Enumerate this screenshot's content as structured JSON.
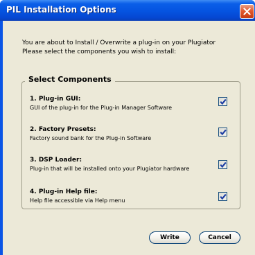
{
  "window": {
    "title": "PIL Installation Options"
  },
  "intro": {
    "line1": "You are about to Install / Overwrite a plug-in on your Plugiator",
    "line2": "Please select the components you wish to install:"
  },
  "group": {
    "legend": "Select Components"
  },
  "components": [
    {
      "name": "1. Plug-in GUI:",
      "description": "GUI of the plug-in for the Plug-in Manager Software",
      "checked": true
    },
    {
      "name": "2. Factory Presets:",
      "description": "Factory sound bank for the Plug-in Software",
      "checked": true
    },
    {
      "name": "3. DSP Loader:",
      "description": "Plug-in that will be installed onto your Plugiator hardware",
      "checked": true
    },
    {
      "name": "4. Plug-in Help file:",
      "description": "Help file accessible via Help menu",
      "checked": true
    }
  ],
  "buttons": {
    "write": "Write",
    "cancel": "Cancel"
  },
  "colors": {
    "titlebar": "#0553e0",
    "dialog_background": "#ece9d8",
    "check_mark": "#1d3ea3"
  },
  "icons": {
    "close": "close-icon",
    "check": "checkmark-icon"
  }
}
